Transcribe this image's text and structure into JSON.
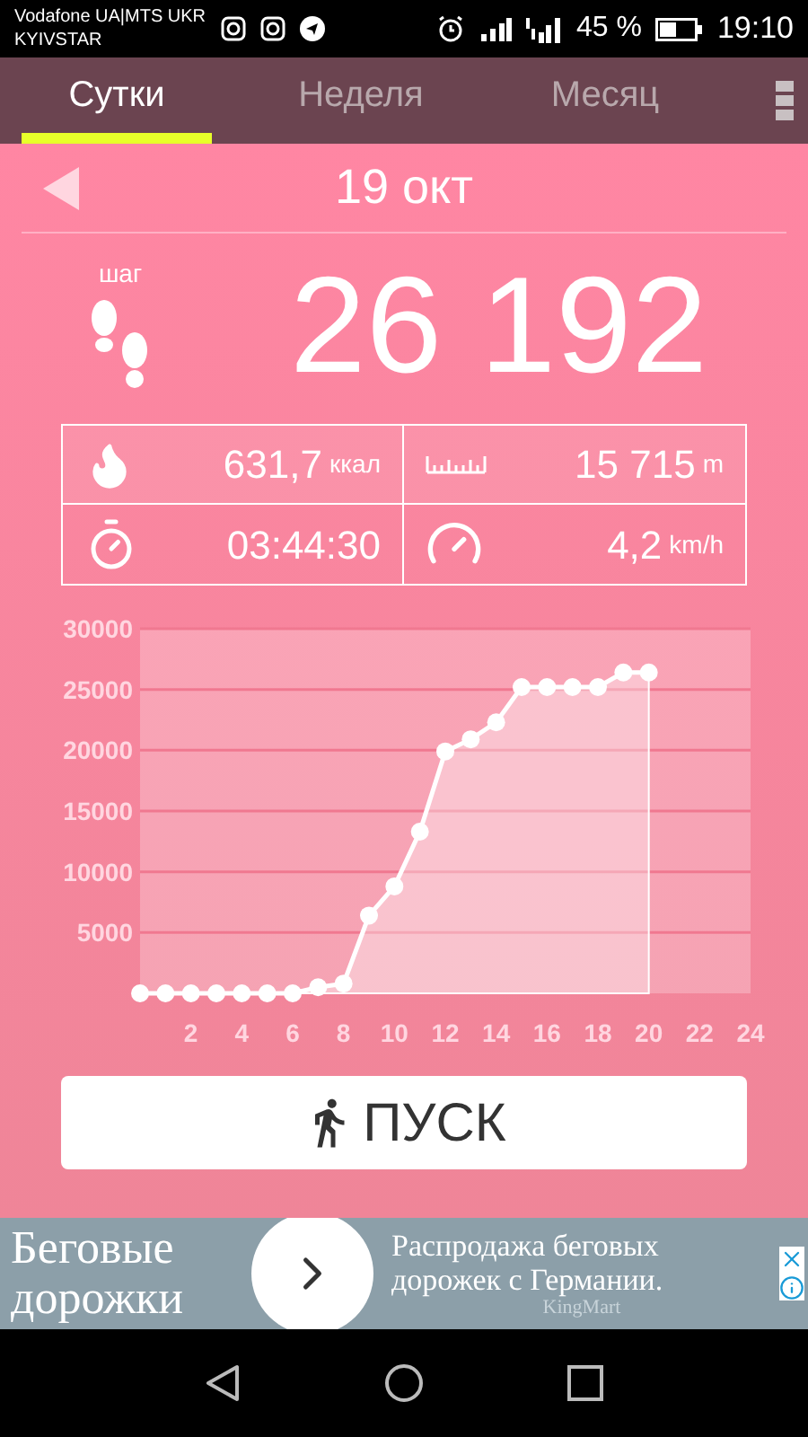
{
  "status_bar": {
    "carrier_1": "Vodafone UA|MTS UKR",
    "carrier_2": "KYIVSTAR",
    "battery": "45 %",
    "time": "19:10"
  },
  "tabs": [
    {
      "label": "Сутки",
      "selected": true
    },
    {
      "label": "Неделя",
      "selected": false
    },
    {
      "label": "Месяц",
      "selected": false
    }
  ],
  "date": "19 окт",
  "steps": {
    "unit": "шаг",
    "value": "26 192"
  },
  "stats": [
    {
      "kind": "calories",
      "value": "631,7",
      "unit": "ккал"
    },
    {
      "kind": "distance",
      "value": "15 715",
      "unit": "m"
    },
    {
      "kind": "duration",
      "value": "03:44:30"
    },
    {
      "kind": "speed",
      "value": "4,2",
      "unit": "km/h"
    }
  ],
  "chart_data": {
    "type": "area",
    "x": [
      0,
      1,
      2,
      3,
      4,
      5,
      6,
      7,
      8,
      9,
      10,
      11,
      12,
      13,
      14,
      15,
      16,
      17,
      18,
      19,
      20
    ],
    "series": [
      {
        "color": "#ffffff",
        "values": [
          0,
          0,
          0,
          0,
          0,
          0,
          0,
          500,
          800,
          6400,
          8800,
          13300,
          19900,
          20900,
          22300,
          25200,
          25200,
          25200,
          25200,
          26400,
          26400
        ]
      }
    ],
    "grid": true,
    "xlim": [
      0,
      24
    ],
    "ylim": [
      0,
      30000
    ],
    "xticks": [
      2,
      4,
      6,
      8,
      10,
      12,
      14,
      16,
      18,
      20,
      22,
      24
    ],
    "yticks": [
      5000,
      10000,
      15000,
      20000,
      25000,
      30000
    ]
  },
  "start_button": "ПУСК",
  "ad": {
    "headline": "Беговые дорожки",
    "text": "Распродажа беговых дорожек с Германии.",
    "advertiser": "KingMart"
  }
}
